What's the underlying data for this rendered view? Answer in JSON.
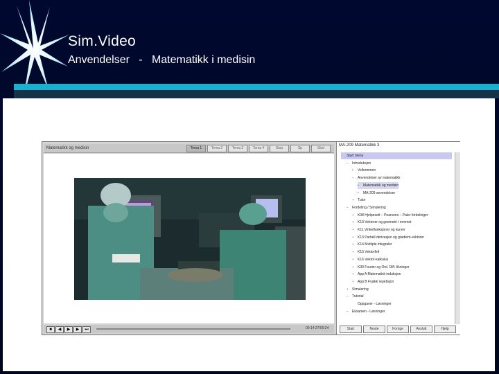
{
  "slide": {
    "title": "Sim.Video",
    "subtitle": "Anvendelser   -   Matematikk i medisin"
  },
  "app": {
    "video_panel_title": "Matematikk og medisin",
    "tabs": [
      "Tema 1",
      "Tema 2",
      "Tema 3",
      "Tema 4",
      "Stop",
      "Sp",
      "Slutt"
    ],
    "time_display": "00:14:27/00:24",
    "controls": [
      "stop-icon",
      "skip-back-icon",
      "play-icon",
      "skip-forward-icon",
      "end-icon"
    ],
    "toc_title": "MA-209 Matematikk 3",
    "toc": [
      {
        "label": "Start menu",
        "indent": 0,
        "glyph": "",
        "selected": true
      },
      {
        "label": "Introduksjon",
        "indent": 1,
        "glyph": "–"
      },
      {
        "label": "Velkommen",
        "indent": 2,
        "glyph": "•"
      },
      {
        "label": "Anvendelser av matematikk",
        "indent": 2,
        "glyph": "–"
      },
      {
        "label": "Matematikk og medisin",
        "indent": 3,
        "glyph": "•",
        "selected": true
      },
      {
        "label": "MA-209 anvendelser",
        "indent": 3,
        "glyph": "•"
      },
      {
        "label": "Tutor",
        "indent": 2,
        "glyph": "+"
      },
      {
        "label": "Fordeling / Simulering",
        "indent": 1,
        "glyph": "–"
      },
      {
        "label": "K08 Hjelpesett – Pearsons – Paler fordelinger",
        "indent": 2,
        "glyph": "+"
      },
      {
        "label": "K10 Vektorer og geometri i rommet",
        "indent": 2,
        "glyph": "+"
      },
      {
        "label": "K11 Vinkelfunksjoner og kurver",
        "indent": 2,
        "glyph": "+"
      },
      {
        "label": "K13 Partiell derivasjon og gradient-vektorer",
        "indent": 2,
        "glyph": "+"
      },
      {
        "label": "K14 Multiple integraler",
        "indent": 2,
        "glyph": "+"
      },
      {
        "label": "K15 Vektorfelt",
        "indent": 2,
        "glyph": "+"
      },
      {
        "label": "K16 Vektor-kalkulus",
        "indent": 2,
        "glyph": "+"
      },
      {
        "label": "K30 Fourier og Ord. Diff.-likninger",
        "indent": 2,
        "glyph": "+"
      },
      {
        "label": "App A Matematisk induksjon",
        "indent": 2,
        "glyph": "+"
      },
      {
        "label": "App B Fysikk repetisjon",
        "indent": 2,
        "glyph": "+"
      },
      {
        "label": "Simulering",
        "indent": 1,
        "glyph": "+"
      },
      {
        "label": "Tutorial",
        "indent": 1,
        "glyph": "–"
      },
      {
        "label": "Oppgaver  -  Løsninger",
        "indent": 2,
        "glyph": ""
      },
      {
        "label": "Eksamen  -  Løsninger",
        "indent": 1,
        "glyph": "–"
      }
    ],
    "nav_buttons": [
      "Start",
      "Neste",
      "Forrige",
      "Avslutt",
      "Hjelp"
    ]
  },
  "colors": {
    "slide_bg": "#000a2a",
    "accent_cyan": "#1ab0cf",
    "content_bg": "#ffffff",
    "selection": "#c8c8f0"
  }
}
